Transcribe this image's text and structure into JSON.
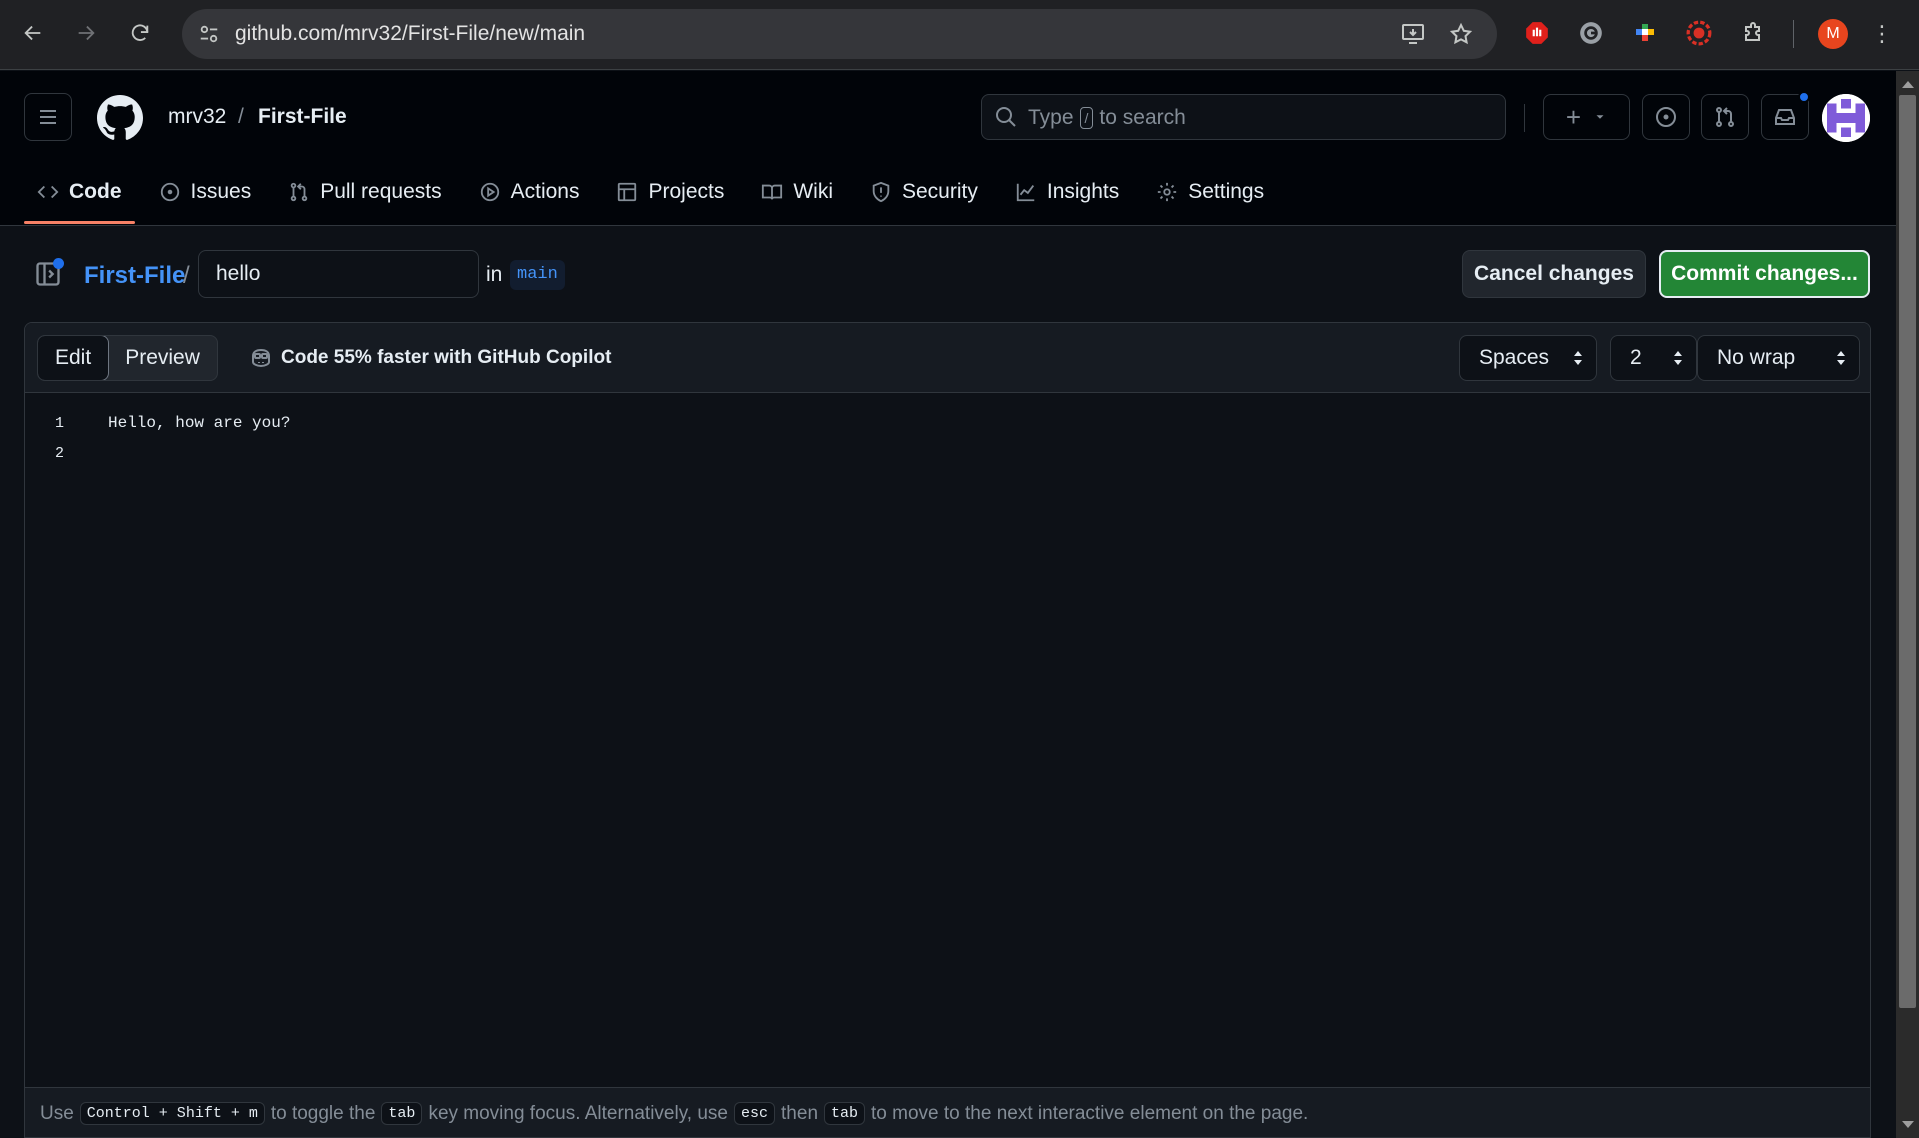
{
  "browser": {
    "url": "github.com/mrv32/First-File/new/main",
    "profile_initial": "M",
    "menu_glyph": "⋮"
  },
  "header": {
    "owner": "mrv32",
    "separator": "/",
    "repo": "First-File",
    "search": {
      "prefix": "Type",
      "key": "/",
      "suffix": "to search"
    },
    "plus_glyph": "+"
  },
  "tabs": [
    {
      "label": "Code",
      "icon": "code-icon",
      "active": true
    },
    {
      "label": "Issues",
      "icon": "issue-opened-icon"
    },
    {
      "label": "Pull requests",
      "icon": "git-pull-request-icon"
    },
    {
      "label": "Actions",
      "icon": "play-icon"
    },
    {
      "label": "Projects",
      "icon": "table-icon"
    },
    {
      "label": "Wiki",
      "icon": "book-icon"
    },
    {
      "label": "Security",
      "icon": "shield-icon"
    },
    {
      "label": "Insights",
      "icon": "graph-icon"
    },
    {
      "label": "Settings",
      "icon": "gear-icon"
    }
  ],
  "file": {
    "repo_link": "First-File",
    "slash": "/",
    "filename": "hello",
    "in_label": "in",
    "branch": "main",
    "cancel_label": "Cancel changes",
    "commit_label": "Commit changes..."
  },
  "editor": {
    "modes": [
      "Edit",
      "Preview"
    ],
    "active_mode": "Edit",
    "copilot_text": "Code 55% faster with GitHub Copilot",
    "indent_mode": "Spaces",
    "indent_size": "2",
    "wrap_mode": "No wrap",
    "lines": [
      {
        "number": "1",
        "text": "Hello, how are you?"
      },
      {
        "number": "2",
        "text": ""
      }
    ]
  },
  "footer": {
    "use": "Use",
    "shortcut": "Control + Shift + m",
    "toggle_text": "to toggle the",
    "tab_key": "tab",
    "moving_text": "key moving focus. Alternatively, use",
    "esc_key": "esc",
    "then_text": "then",
    "tab_key2": "tab",
    "end_text": "to move to the next interactive element on the page."
  },
  "colors": {
    "accent": "#4493f8",
    "commit_green": "#238636",
    "active_tab_underline": "#f78166",
    "background": "#0d1117"
  }
}
